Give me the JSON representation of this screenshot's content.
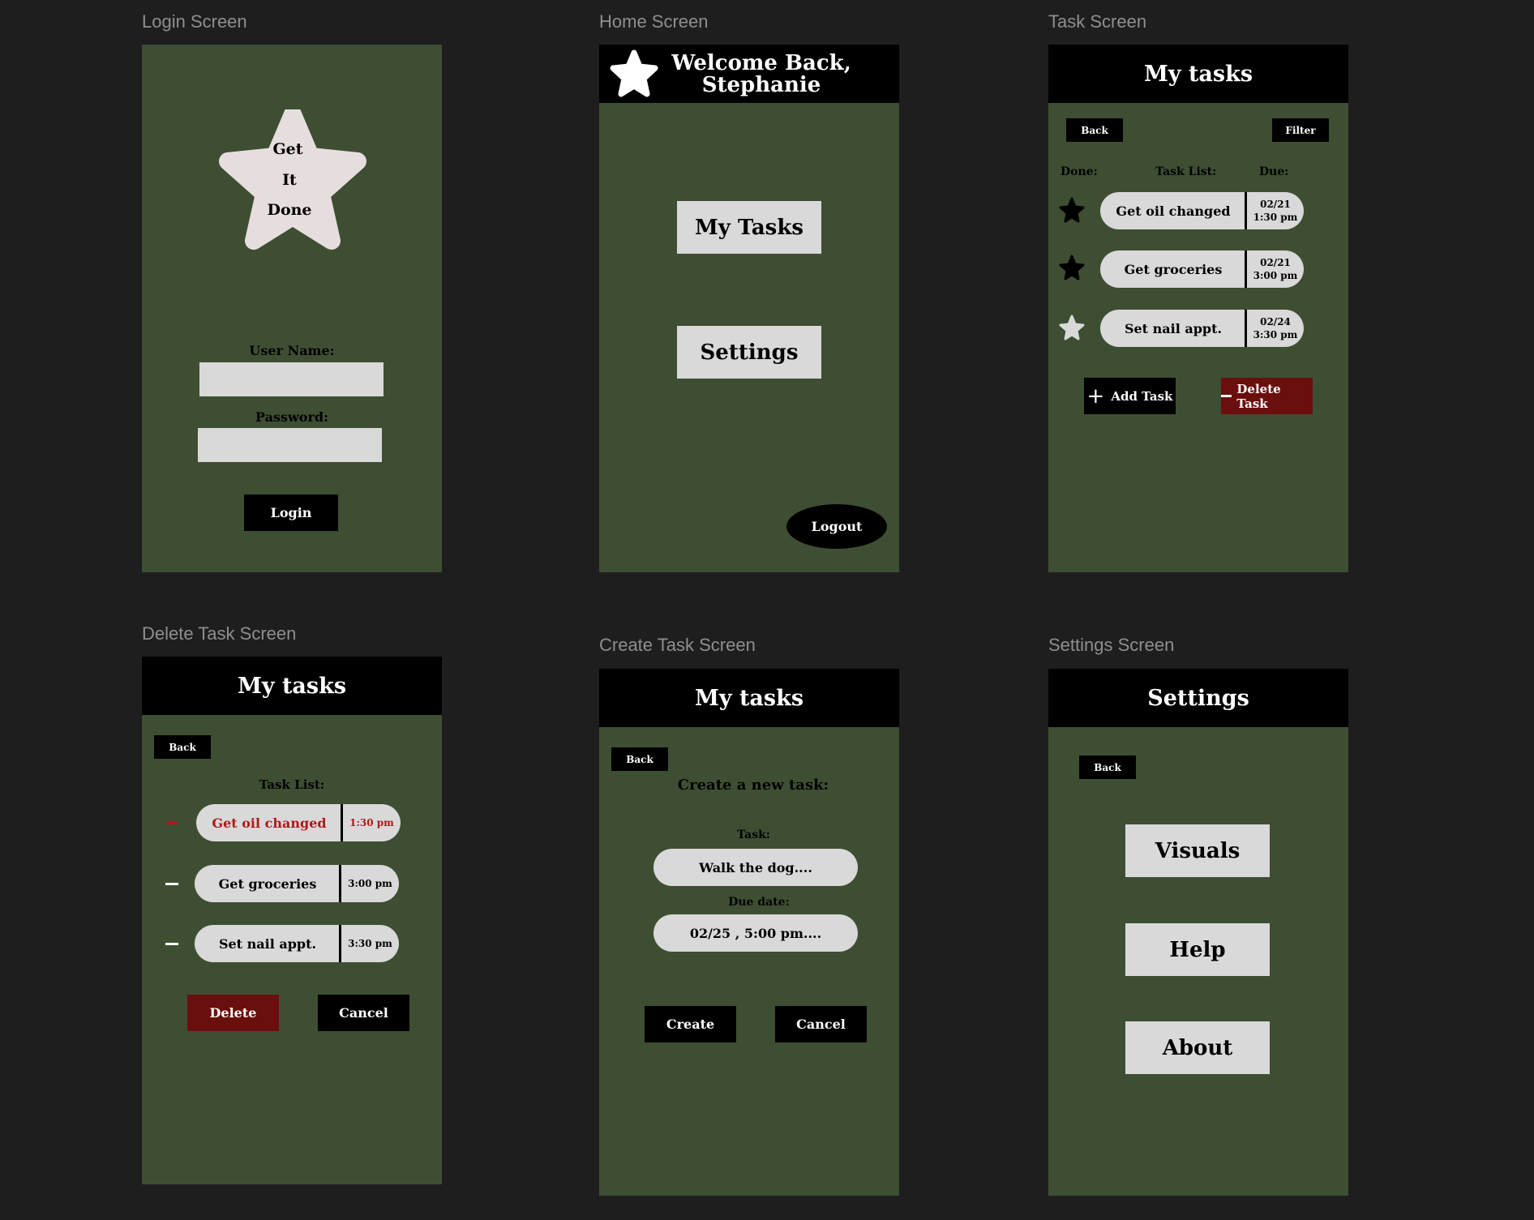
{
  "colors": {
    "canvas": "#1e1e1e",
    "screen_bg": "#3e4e33",
    "header_bg": "#000000",
    "light_fill": "#d9d9d9",
    "danger": "#6b0e0e",
    "danger_text": "#b01818",
    "frame_label": "#8f8f8f"
  },
  "login": {
    "frame_label": "Login Screen",
    "logo_lines": [
      "Get",
      "It",
      "Done"
    ],
    "username_label": "User Name:",
    "password_label": "Password:",
    "login_button": "Login"
  },
  "home": {
    "frame_label": "Home Screen",
    "welcome_line1": "Welcome Back,",
    "welcome_line2": "Stephanie",
    "my_tasks_button": "My Tasks",
    "settings_button": "Settings",
    "logout_button": "Logout",
    "star_icon": "star-icon"
  },
  "task": {
    "frame_label": "Task Screen",
    "title": "My tasks",
    "back_button": "Back",
    "filter_button": "Filter",
    "col_done": "Done:",
    "col_task_list": "Task List:",
    "col_due": "Due:",
    "tasks": [
      {
        "name": "Get oil changed",
        "due_date": "02/21",
        "due_time": "1:30 pm",
        "done_icon": "star-filled-icon"
      },
      {
        "name": "Get groceries",
        "due_date": "02/21",
        "due_time": "3:00 pm",
        "done_icon": "star-filled-icon"
      },
      {
        "name": "Set nail appt.",
        "due_date": "02/24",
        "due_time": "3:30 pm",
        "done_icon": "star-light-icon"
      }
    ],
    "add_task_button": "Add Task",
    "delete_task_button": "Delete Task"
  },
  "delete": {
    "frame_label": "Delete Task Screen",
    "title": "My tasks",
    "back_button": "Back",
    "task_list_label": "Task List:",
    "tasks": [
      {
        "name": "Get oil changed",
        "time": "1:30 pm",
        "selected": true
      },
      {
        "name": "Get groceries",
        "time": "3:00 pm",
        "selected": false
      },
      {
        "name": "Set nail appt.",
        "time": "3:30 pm",
        "selected": false
      }
    ],
    "delete_button": "Delete",
    "cancel_button": "Cancel"
  },
  "create": {
    "frame_label": "Create Task Screen",
    "title": "My tasks",
    "back_button": "Back",
    "heading": "Create a new task:",
    "task_label": "Task:",
    "task_value": "Walk the dog....",
    "due_label": "Due date:",
    "due_value": "02/25 , 5:00 pm....",
    "create_button": "Create",
    "cancel_button": "Cancel"
  },
  "settings": {
    "frame_label": "Settings Screen",
    "title": "Settings",
    "back_button": "Back",
    "visuals_button": "Visuals",
    "help_button": "Help",
    "about_button": "About"
  }
}
